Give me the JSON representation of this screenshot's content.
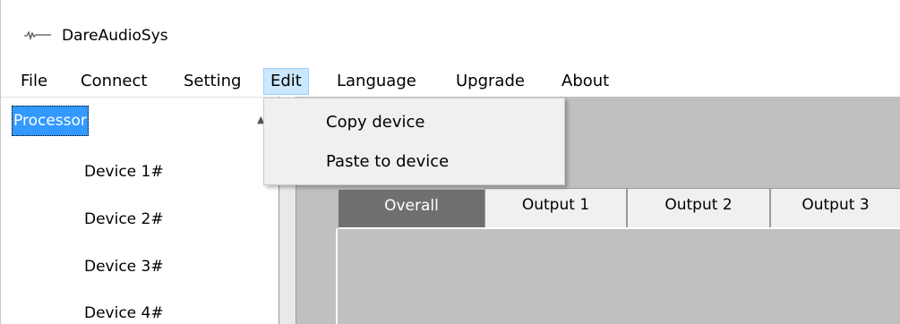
{
  "window": {
    "title": "DareAudioSys",
    "icon": "audio-waveform-icon"
  },
  "menu": {
    "items": [
      {
        "label": "File"
      },
      {
        "label": "Connect"
      },
      {
        "label": "Setting"
      },
      {
        "label": "Edit"
      },
      {
        "label": "Language"
      },
      {
        "label": "Upgrade"
      },
      {
        "label": "About"
      }
    ],
    "open_item": "Edit",
    "dropdown": [
      {
        "label": "Copy device"
      },
      {
        "label": "Paste to device"
      }
    ]
  },
  "tree": {
    "root": "Processor",
    "devices": [
      "Device 1#",
      "Device 2#",
      "Device 3#",
      "Device 4#"
    ]
  },
  "tabs": [
    {
      "label": "Overall",
      "active": true
    },
    {
      "label": "Output 1",
      "active": false
    },
    {
      "label": "Output 2",
      "active": false
    },
    {
      "label": "Output 3",
      "active": false
    }
  ],
  "colors": {
    "selection": "#3399ff",
    "menu_open_bg": "#cce8ff",
    "active_tab": "#707070",
    "pane_bg": "#c0c0c0"
  }
}
